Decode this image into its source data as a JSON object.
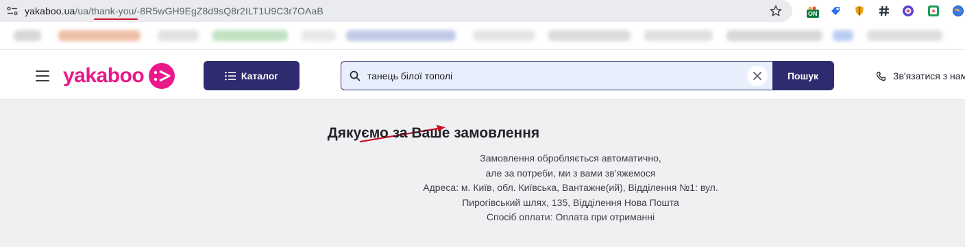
{
  "browser": {
    "url_host": "yakaboo.ua",
    "url_path": "/ua/thank-you/-8R5wGH9EgZ8d9sQ8r2ILT1U9C3r7OAaB",
    "extension_on_badge": "ON",
    "icons": [
      "site-info-icon",
      "star-icon"
    ]
  },
  "header": {
    "logo_text": "yakaboo",
    "catalog_label": "Каталог",
    "search_value": "танець білої тополі",
    "search_button_label": "Пошук",
    "contact_label": "Зв'язатися з нам"
  },
  "thank_you": {
    "title": "Дякуємо за Ваше замовлення",
    "lines": [
      "Замовлення обробляється автоматично,",
      "але за потреби, ми з вами зв’яжемося",
      "Адреса: м. Київ, обл. Київська, Вантажне(ий), Відділення №1: вул.",
      "Пирогівський шлях, 135, Відділення Нова Пошта",
      "Спосіб оплати: Оплата при отриманні"
    ]
  },
  "colors": {
    "brand_pink": "#ea1889",
    "brand_navy": "#2e2c6e",
    "annotation_red": "#d0112b",
    "page_bg": "#f0f0f2"
  }
}
